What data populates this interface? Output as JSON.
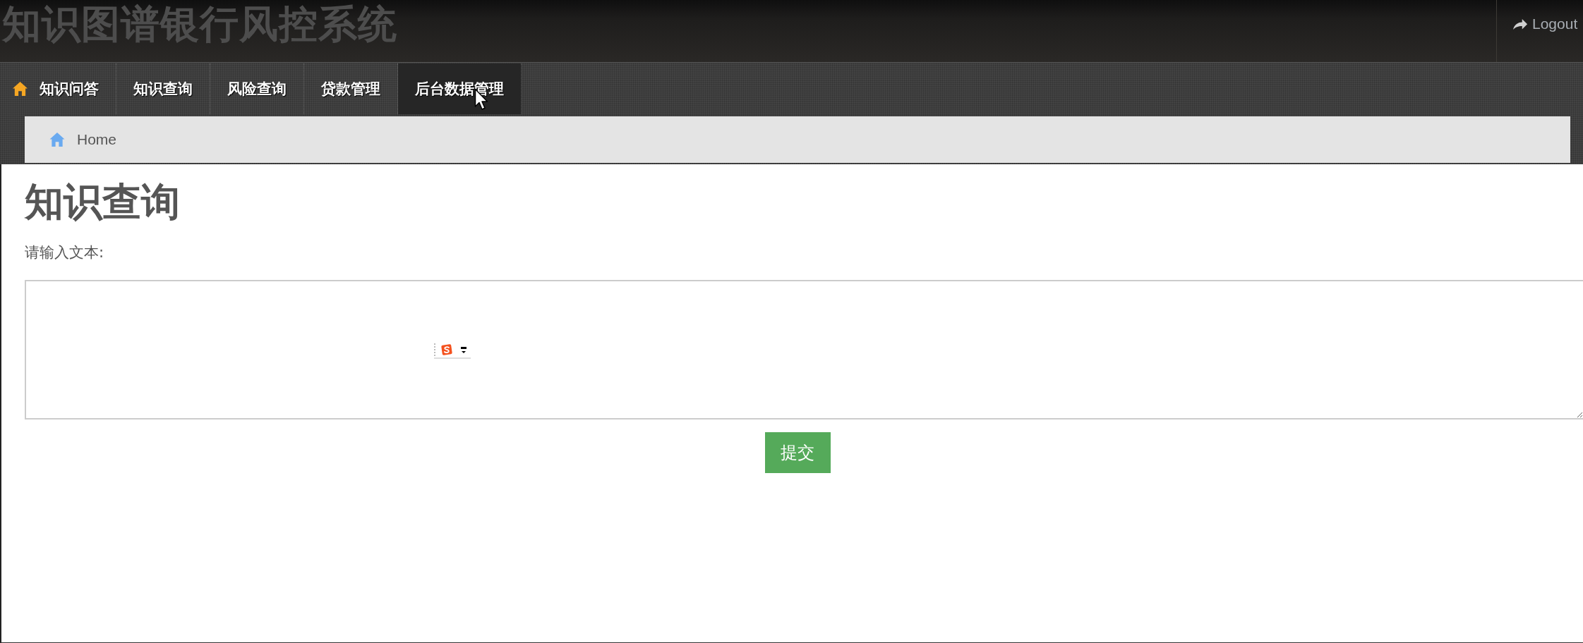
{
  "header": {
    "title": "知识图谱银行风控系统",
    "logout": "Logout"
  },
  "nav": [
    {
      "label": "知识问答",
      "kind": "home",
      "selected": false
    },
    {
      "label": "知识查询",
      "kind": "plain",
      "selected": false
    },
    {
      "label": "风险查询",
      "kind": "plain",
      "selected": false
    },
    {
      "label": "贷款管理",
      "kind": "plain",
      "selected": false
    },
    {
      "label": "后台数据管理",
      "kind": "plain",
      "selected": true
    }
  ],
  "breadcrumb": [
    {
      "label": "Home",
      "kind": "home"
    }
  ],
  "page": {
    "heading": "知识查询",
    "label": "请输入文本:",
    "submit": "提交"
  }
}
